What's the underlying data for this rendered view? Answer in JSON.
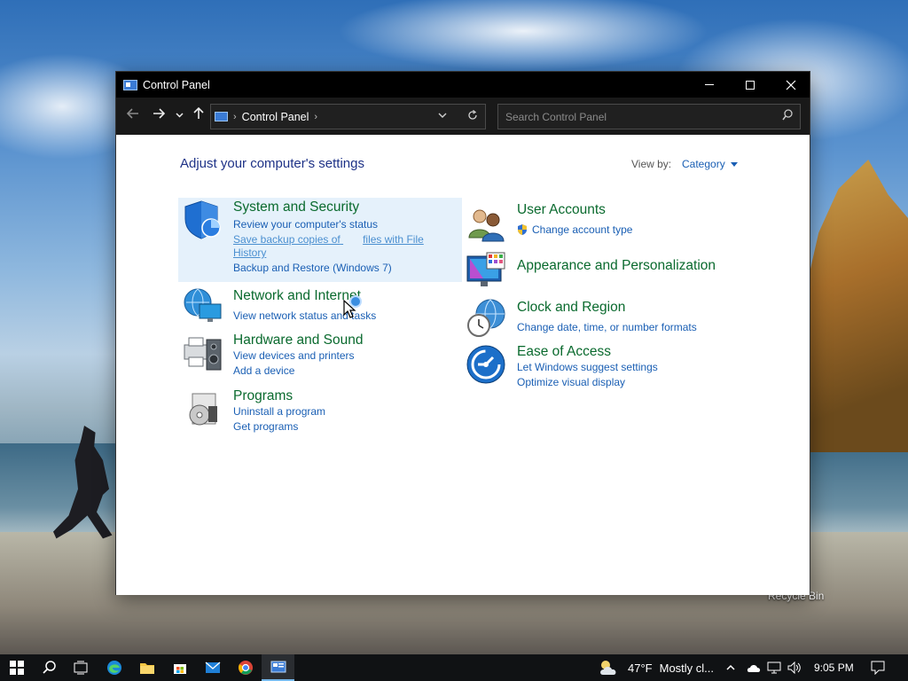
{
  "window": {
    "title": "Control Panel",
    "minimize_icon": "minimize-icon",
    "maximize_icon": "maximize-icon",
    "close_icon": "close-icon"
  },
  "navigation": {
    "back_icon": "arrow-left-icon",
    "forward_icon": "arrow-right-icon",
    "recent_icon": "chevron-down-icon",
    "up_icon": "arrow-up-icon",
    "address": {
      "breadcrumb": "Control Panel",
      "dropdown_icon": "chevron-down-icon",
      "refresh_icon": "refresh-icon"
    },
    "search": {
      "placeholder": "Search Control Panel",
      "value": ""
    }
  },
  "content": {
    "heading": "Adjust your computer's settings",
    "view_by_label": "View by:",
    "view_by_value": "Category",
    "categories_left": [
      {
        "title": "System and Security",
        "icon": "shield-icon",
        "links": [
          "Review your computer's status",
          "Save backup copies of",
          "files with File",
          "History",
          "Backup and Restore (Windows 7)"
        ]
      },
      {
        "title": "Network and Internet",
        "icon": "network-globe-icon",
        "links": [
          "View network status and tasks"
        ]
      },
      {
        "title": "Hardware and Sound",
        "icon": "printer-speaker-icon",
        "links": [
          "View devices and printers",
          "Add a device"
        ]
      },
      {
        "title": "Programs",
        "icon": "programs-disc-icon",
        "links": [
          "Uninstall a program",
          "Get programs"
        ]
      }
    ],
    "categories_right": [
      {
        "title": "User Accounts",
        "icon": "users-icon",
        "links": [
          "Change account type"
        ]
      },
      {
        "title": "Appearance and Personalization",
        "icon": "monitor-palette-icon",
        "links": []
      },
      {
        "title": "Clock and Region",
        "icon": "clock-globe-icon",
        "links": [
          "Change date, time, or number formats"
        ]
      },
      {
        "title": "Ease of Access",
        "icon": "ease-of-access-icon",
        "links": [
          "Let Windows suggest settings",
          "Optimize visual display"
        ]
      }
    ]
  },
  "desktop": {
    "recycle_bin_label": "Recycle Bin"
  },
  "taskbar": {
    "apps": [
      "start-icon",
      "search-icon",
      "task-view-icon",
      "edge-icon",
      "file-explorer-icon",
      "store-icon",
      "mail-icon",
      "chrome-icon",
      "control-panel-icon"
    ],
    "weather_temp": "47°F",
    "weather_text": "Mostly cl...",
    "time": "9:05 PM"
  },
  "colors": {
    "accent": "#1a5fb4",
    "category_title": "#0a6a2e",
    "heading": "#1e3287",
    "hover_bg": "#e5f1fb",
    "taskbar_bg": "#101214",
    "titlebar_bg": "#000000"
  }
}
